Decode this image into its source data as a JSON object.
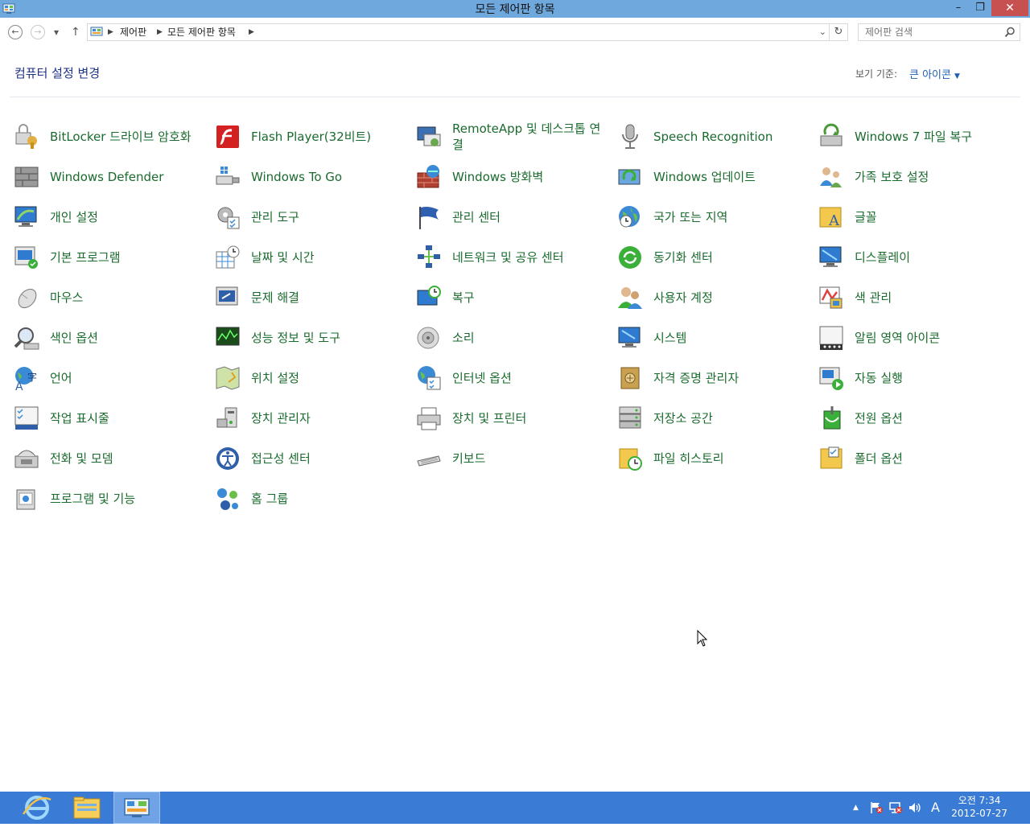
{
  "window": {
    "title": "모든 제어판 항목",
    "minimize": "–",
    "maximize": "❐",
    "close": "✕"
  },
  "nav": {
    "back": "←",
    "forward": "→",
    "recent": "▾",
    "up": "↑",
    "breadcrumbs": [
      "제어판",
      "모든 제어판 항목"
    ],
    "separator": "▶",
    "dropdown": "⌄",
    "refresh": "↻",
    "search_placeholder": "제어판 검색"
  },
  "header": {
    "title": "컴퓨터 설정 변경",
    "view_by_label": "보기 기준:",
    "view_by_value": "큰 아이콘",
    "caret": "▼"
  },
  "items": [
    {
      "label": "BitLocker 드라이브 암호화",
      "icon": "bitlocker-icon"
    },
    {
      "label": "Flash Player(32비트)",
      "icon": "flash-icon"
    },
    {
      "label": "RemoteApp 및 데스크톱 연결",
      "icon": "remoteapp-icon"
    },
    {
      "label": "Speech Recognition",
      "icon": "microphone-icon"
    },
    {
      "label": "Windows 7 파일 복구",
      "icon": "file-recovery-icon"
    },
    {
      "label": "Windows Defender",
      "icon": "defender-icon"
    },
    {
      "label": "Windows To Go",
      "icon": "usb-drive-icon"
    },
    {
      "label": "Windows 방화벽",
      "icon": "firewall-icon"
    },
    {
      "label": "Windows 업데이트",
      "icon": "update-icon"
    },
    {
      "label": "가족 보호 설정",
      "icon": "family-safety-icon"
    },
    {
      "label": "개인 설정",
      "icon": "personalization-icon"
    },
    {
      "label": "관리 도구",
      "icon": "admin-tools-icon"
    },
    {
      "label": "관리 센터",
      "icon": "action-center-flag-icon"
    },
    {
      "label": "국가 또는 지역",
      "icon": "region-globe-icon"
    },
    {
      "label": "글꼴",
      "icon": "fonts-folder-icon"
    },
    {
      "label": "기본 프로그램",
      "icon": "default-programs-icon"
    },
    {
      "label": "날짜 및 시간",
      "icon": "calendar-clock-icon"
    },
    {
      "label": "네트워크 및 공유 센터",
      "icon": "network-icon"
    },
    {
      "label": "동기화 센터",
      "icon": "sync-icon"
    },
    {
      "label": "디스플레이",
      "icon": "display-icon"
    },
    {
      "label": "마우스",
      "icon": "mouse-icon"
    },
    {
      "label": "문제 해결",
      "icon": "troubleshooting-icon"
    },
    {
      "label": "복구",
      "icon": "recovery-icon"
    },
    {
      "label": "사용자 계정",
      "icon": "user-accounts-icon"
    },
    {
      "label": "색 관리",
      "icon": "color-management-icon"
    },
    {
      "label": "색인 옵션",
      "icon": "indexing-icon"
    },
    {
      "label": "성능 정보 및 도구",
      "icon": "performance-icon"
    },
    {
      "label": "소리",
      "icon": "speaker-icon"
    },
    {
      "label": "시스템",
      "icon": "system-icon"
    },
    {
      "label": "알림 영역 아이콘",
      "icon": "notification-area-icon"
    },
    {
      "label": "언어",
      "icon": "language-icon"
    },
    {
      "label": "위치 설정",
      "icon": "location-icon"
    },
    {
      "label": "인터넷 옵션",
      "icon": "internet-options-icon"
    },
    {
      "label": "자격 증명 관리자",
      "icon": "credential-vault-icon"
    },
    {
      "label": "자동 실행",
      "icon": "autoplay-icon"
    },
    {
      "label": "작업 표시줄",
      "icon": "taskbar-icon"
    },
    {
      "label": "장치 관리자",
      "icon": "device-manager-icon"
    },
    {
      "label": "장치 및 프린터",
      "icon": "printer-icon"
    },
    {
      "label": "저장소 공간",
      "icon": "storage-spaces-icon"
    },
    {
      "label": "전원 옵션",
      "icon": "power-options-icon"
    },
    {
      "label": "전화 및 모뎀",
      "icon": "phone-modem-icon"
    },
    {
      "label": "접근성 센터",
      "icon": "ease-of-access-icon"
    },
    {
      "label": "키보드",
      "icon": "keyboard-icon"
    },
    {
      "label": "파일 히스토리",
      "icon": "file-history-icon"
    },
    {
      "label": "폴더 옵션",
      "icon": "folder-options-icon"
    },
    {
      "label": "프로그램 및 기능",
      "icon": "programs-features-icon"
    },
    {
      "label": "홈 그룹",
      "icon": "homegroup-icon"
    }
  ],
  "taskbar": {
    "tray_arrow": "▲",
    "input_indicator": "A",
    "time": "오전 7:34",
    "date": "2012-07-27"
  }
}
